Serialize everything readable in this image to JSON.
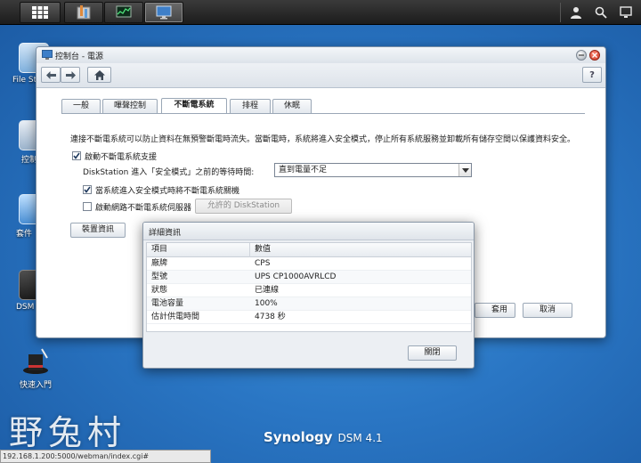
{
  "window": {
    "title": "控制台 - 電源",
    "help_label": "?"
  },
  "desktop": {
    "icons": [
      {
        "label": "File St",
        "name": "file-station-icon"
      },
      {
        "label": "控制",
        "name": "control-panel-icon"
      },
      {
        "label": "套件",
        "name": "package-center-icon"
      },
      {
        "label": "DSM",
        "name": "dsm-help-icon"
      },
      {
        "label": "快速入門",
        "name": "quick-start-icon"
      }
    ]
  },
  "tabs": [
    {
      "label": "一般"
    },
    {
      "label": "嗶聲控制"
    },
    {
      "label": "不斷電系統"
    },
    {
      "label": "排程"
    },
    {
      "label": "休眠"
    }
  ],
  "content": {
    "description": "連接不斷電系統可以防止資料在無預警斷電時流失。當斷電時，系統將進入安全模式，停止所有系統服務並卸載所有儲存空間以保護資料安全。",
    "enable_ups_label": "啟動不斷電系統支援",
    "enable_ups_checked": true,
    "wait_time_label": "DiskStation 進入「安全模式」之前的等待時間:",
    "wait_time_value": "直到電量不足",
    "shutdown_ups_label": "當系統進入安全模式時將不斷電系統關機",
    "shutdown_ups_checked": true,
    "network_ups_label": "啟動網路不斷電系統伺服器",
    "network_ups_checked": false,
    "allowed_button": "允許的 DiskStation",
    "device_info_button": "裝置資訊",
    "apply_button": "套用",
    "cancel_button": "取消"
  },
  "dialog": {
    "title": "詳細資訊",
    "columns": [
      "項目",
      "數值"
    ],
    "rows": [
      {
        "item": "廠牌",
        "value": "CPS"
      },
      {
        "item": "型號",
        "value": "UPS CP1000AVRLCD"
      },
      {
        "item": "狀態",
        "value": "已連線"
      },
      {
        "item": "電池容量",
        "value": "100%"
      },
      {
        "item": "估計供電時間",
        "value": "4738 秒"
      }
    ],
    "close_button": "關閉"
  },
  "footer": {
    "status_url": "192.168.1.200:5000/webman/index.cgi#",
    "brand": "Synology",
    "version": "DSM 4.1",
    "watermark": "野兔村"
  },
  "colors": {
    "desktop": "#2a76c4",
    "taskbar": "#2a2a2a",
    "accent": "#1f5fa8"
  }
}
